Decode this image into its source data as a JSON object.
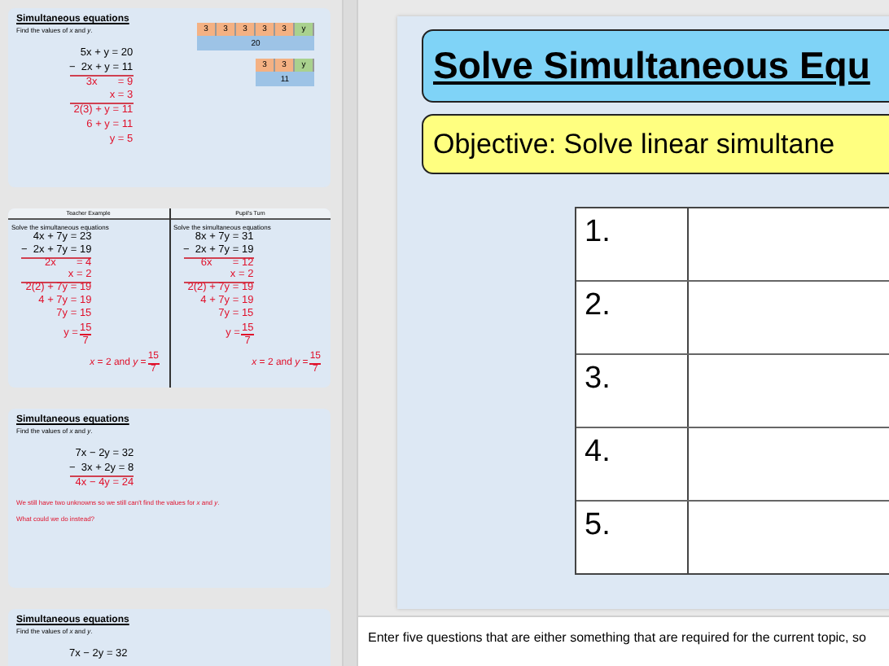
{
  "thumbnails": [
    {
      "kind": "bar_model",
      "title": "Simultaneous equations",
      "subtitle": "Find the values of *x* and *y*.",
      "lines": [
        {
          "text": "5x + y = 20",
          "color": "#000000",
          "rule": false
        },
        {
          "text": "−  2x + y = 11",
          "color": "#000000",
          "rule": true
        },
        {
          "text": "3x       = 9",
          "color": "#e0102a",
          "rule": false
        },
        {
          "text": "x = 3",
          "color": "#e0102a",
          "rule": true
        },
        {
          "text": "2(3) + y = 11",
          "color": "#e0102a",
          "rule": false
        },
        {
          "text": "6 + y = 11",
          "color": "#e0102a",
          "rule": false
        },
        {
          "text": "y = 5",
          "color": "#e0102a",
          "rule": false
        }
      ],
      "bars": [
        {
          "cells": [
            {
              "text": "3",
              "kind": "part"
            },
            {
              "text": "3",
              "kind": "part"
            },
            {
              "text": "3",
              "kind": "part"
            },
            {
              "text": "3",
              "kind": "part"
            },
            {
              "text": "3",
              "kind": "part"
            },
            {
              "text": "y",
              "kind": "unknown"
            }
          ],
          "total": "20"
        },
        {
          "cells": [
            {
              "text": "3",
              "kind": "part"
            },
            {
              "text": "3",
              "kind": "part"
            },
            {
              "text": "y",
              "kind": "unknown"
            }
          ],
          "total": "11"
        }
      ]
    },
    {
      "kind": "comparison",
      "columns": [
        {
          "header": "Teacher Example",
          "prompt": "Solve the simultaneous equations",
          "lines": [
            {
              "text": "4x + 7y = 23",
              "color": "#000000",
              "rule": false
            },
            {
              "text": "−  2x + 7y = 19",
              "color": "#000000",
              "rule": true
            },
            {
              "text": "2x       = 4",
              "color": "#e0102a",
              "rule": false
            },
            {
              "text": "x = 2",
              "color": "#e0102a",
              "rule": true
            },
            {
              "text": "2(2) + 7y = 19",
              "color": "#e0102a",
              "rule": false
            },
            {
              "text": "4 + 7y = 19",
              "color": "#e0102a",
              "rule": false
            },
            {
              "text": "7y = 15",
              "color": "#e0102a",
              "rule": false
            },
            {
              "text": "y =",
              "num": "15",
              "den": "7",
              "color": "#e0102a",
              "rule": false
            }
          ],
          "answer": {
            "text": "*x* = 2 and *y* =",
            "num": "15",
            "den": "7"
          }
        },
        {
          "header": "Pupil's Turn",
          "prompt": "Solve the simultaneous equations",
          "lines": [
            {
              "text": "8x + 7y = 31",
              "color": "#000000",
              "rule": false
            },
            {
              "text": "−  2x + 7y = 19",
              "color": "#000000",
              "rule": true
            },
            {
              "text": "6x       = 12",
              "color": "#e0102a",
              "rule": false
            },
            {
              "text": "x = 2",
              "color": "#e0102a",
              "rule": true
            },
            {
              "text": "2(2) + 7y = 19",
              "color": "#e0102a",
              "rule": false
            },
            {
              "text": "4 + 7y = 19",
              "color": "#e0102a",
              "rule": false
            },
            {
              "text": "7y = 15",
              "color": "#e0102a",
              "rule": false
            },
            {
              "text": "y =",
              "num": "15",
              "den": "7",
              "color": "#e0102a",
              "rule": false
            }
          ],
          "answer": {
            "text": "*x* = 2 and *y* =",
            "num": "15",
            "den": "7"
          }
        }
      ]
    },
    {
      "kind": "worked",
      "title": "Simultaneous equations",
      "subtitle": "Find the values of *x* and *y*.",
      "lines": [
        {
          "text": "7x − 2y = 32",
          "color": "#000000",
          "rule": false
        },
        {
          "text": "−  3x + 2y = 8",
          "color": "#000000",
          "rule": true
        },
        {
          "text": "4x − 4y = 24",
          "color": "#e0102a",
          "rule": false
        }
      ],
      "notes": [
        "We still have two unknowns so we still can't find the values for *x* and *y*.",
        "What could we do instead?"
      ]
    },
    {
      "kind": "worked",
      "title": "Simultaneous equations",
      "subtitle": "Find the values of *x* and *y*.",
      "lines": [
        {
          "text": "7x − 2y = 32",
          "color": "#000000",
          "rule": false
        }
      ]
    }
  ],
  "slide": {
    "title": "Solve Simultaneous Equ",
    "objective": "Objective: Solve linear simultane",
    "rows": [
      {
        "number": "1."
      },
      {
        "number": "2."
      },
      {
        "number": "3."
      },
      {
        "number": "4."
      },
      {
        "number": "5."
      }
    ]
  },
  "notes": "Enter five questions that are either something that are required for the current topic, so"
}
